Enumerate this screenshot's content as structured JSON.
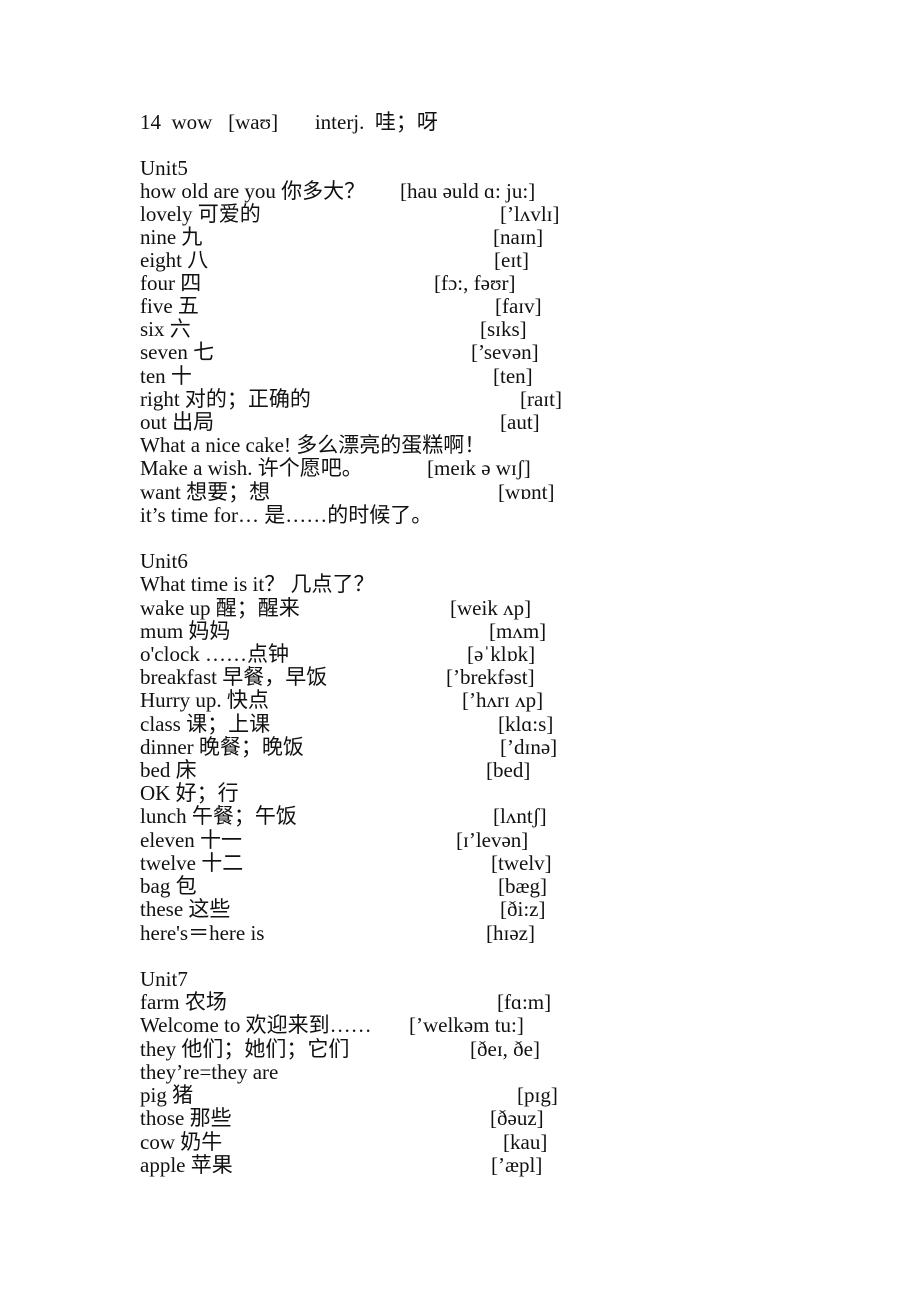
{
  "document": {
    "intro_line": {
      "text": "14  wow   [waʊ]       interj.  哇；呀"
    },
    "units": [
      {
        "title": "Unit5",
        "entries": [
          {
            "term": "how old are you 你多大？",
            "ipa": "[hau əuld ɑ: ju:]"
          },
          {
            "term": "lovely  可爱的",
            "ipa": "[’lʌvlɪ]"
          },
          {
            "term": "nine  九",
            "ipa": "[naɪn]"
          },
          {
            "term": "eight 八",
            "ipa": "[eɪt]"
          },
          {
            "term": "four  四",
            "ipa": "[fɔ:, fəʊr]"
          },
          {
            "term": "five 五",
            "ipa": "[faɪv]"
          },
          {
            "term": "six  六",
            "ipa": "[sɪks]"
          },
          {
            "term": "seven  七",
            "ipa": "[’sevən]"
          },
          {
            "term": "ten  十",
            "ipa": "[ten]"
          },
          {
            "term": "right  对的；正确的",
            "ipa": "[raɪt]"
          },
          {
            "term": "out 出局",
            "ipa": "[aut]"
          },
          {
            "term": "What a nice cake!  多么漂亮的蛋糕啊！",
            "ipa": ""
          },
          {
            "term": "Make a wish.  许个愿吧。",
            "ipa": "[meɪk ə wɪʃ]"
          },
          {
            "term": "want  想要；想",
            "ipa": "[wɒnt]"
          },
          {
            "term": "it’s time for…  是……的时候了。",
            "ipa": ""
          }
        ]
      },
      {
        "title": "Unit6",
        "entries": [
          {
            "term": "What time is it？ 几点了？",
            "ipa": ""
          },
          {
            "term": "wake up  醒；醒来",
            "ipa": "[weik ʌp]"
          },
          {
            "term": "mum  妈妈",
            "ipa": "[mʌm]"
          },
          {
            "term": "o'clock ……点钟",
            "ipa": "[əˈklɒk]"
          },
          {
            "term": "breakfast  早餐，早饭",
            "ipa": "[’brekfəst]"
          },
          {
            "term": "Hurry up.  快点",
            "ipa": "[’hʌrɪ ʌp]"
          },
          {
            "term": "class  课；上课",
            "ipa": "[klɑ:s]"
          },
          {
            "term": "dinner  晚餐；晚饭",
            "ipa": "[’dɪnə]"
          },
          {
            "term": "bed  床",
            "ipa": "[bed]"
          },
          {
            "term": "OK  好；行",
            "ipa": ""
          },
          {
            "term": "lunch  午餐；午饭",
            "ipa": "[lʌntʃ]"
          },
          {
            "term": "eleven  十一",
            "ipa": "[ɪ’levən]"
          },
          {
            "term": "twelve  十二",
            "ipa": "[twelv]"
          },
          {
            "term": "bag  包",
            "ipa": "[bæg]"
          },
          {
            "term": "these  这些",
            "ipa": "[ði:z]"
          },
          {
            "term": "here's＝here is",
            "ipa": "[hɪəz]"
          }
        ]
      },
      {
        "title": "Unit7",
        "entries": [
          {
            "term": "farm  农场",
            "ipa": "[fɑ:m]"
          },
          {
            "term": "Welcome to  欢迎来到……",
            "ipa": "[’welkəm tu:]"
          },
          {
            "term": "they  他们；她们；它们",
            "ipa": "[ðeɪ, ðe]"
          },
          {
            "term": "they’re=they are",
            "ipa": ""
          },
          {
            "term": "pig  猪",
            "ipa": "[pɪg]"
          },
          {
            "term": "those  那些",
            "ipa": "[ðəuz]"
          },
          {
            "term": "cow  奶牛",
            "ipa": "[kau]"
          },
          {
            "term": "apple  苹果",
            "ipa": "[’æpl]"
          }
        ]
      }
    ]
  }
}
